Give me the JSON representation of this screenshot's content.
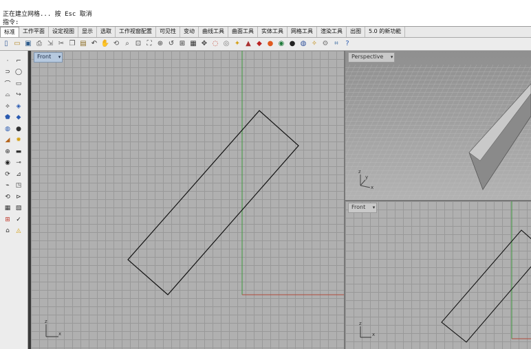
{
  "command_area": {
    "line1": "正在建立网格... 按 Esc 取消",
    "prompt": "指令:"
  },
  "tabs": [
    "标准",
    "工作平面",
    "设定视图",
    "显示",
    "选取",
    "工作视窗配置",
    "可见性",
    "变动",
    "曲线工具",
    "曲面工具",
    "实体工具",
    "网格工具",
    "渲染工具",
    "出图",
    "5.0 的新功能"
  ],
  "active_tab": "标准",
  "toolbar_icons": [
    "new-file-icon",
    "open-folder-icon",
    "save-icon",
    "print-icon",
    "import-icon",
    "cut-icon",
    "copy-icon",
    "paste-icon",
    "undo-icon",
    "pan-hand-icon",
    "rotate-view-icon",
    "zoom-icon",
    "zoom-window-icon",
    "zoom-extents-icon",
    "zoom-selected-icon",
    "undo-view-icon",
    "four-viewports-icon",
    "construction-plane-icon",
    "move-icon",
    "hide-icon",
    "show-icon",
    "light-icon",
    "lock-icon",
    "layer-icon",
    "render-icon",
    "material-icon",
    "sphere-icon",
    "globe-icon",
    "wand-icon",
    "options-icon",
    "grid-snap-icon",
    "help-icon"
  ],
  "viewports": {
    "front_main": {
      "label": "Front"
    },
    "perspective": {
      "label": "Perspective"
    },
    "front_small": {
      "label": "Front"
    }
  },
  "axis_labels": {
    "x": "x",
    "y": "y",
    "z": "z"
  },
  "colors": {
    "grid_bg": "#b0b0b0",
    "grid_line": "#999999",
    "x_axis": "#b04a3a",
    "y_axis": "#3e9a3e",
    "curve": "#111111",
    "active_label": "#b6c9df"
  }
}
